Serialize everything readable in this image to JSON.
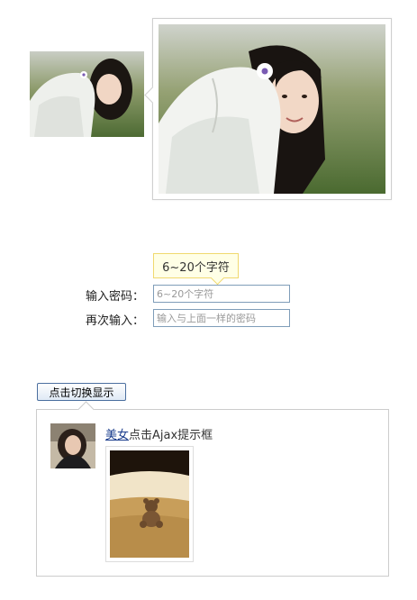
{
  "zoom_demo": {
    "small_image_icon": "girl-photo-thumbnail",
    "large_image_icon": "girl-photo-enlarged"
  },
  "password_form": {
    "tip_text": "6~20个字符",
    "password_label": "输入密码：",
    "password_placeholder": "6~20个字符",
    "confirm_label": "再次输入：",
    "confirm_placeholder": "输入与上面一样的密码"
  },
  "ajax_demo": {
    "toggle_label": "点击切换显示",
    "user_link": "美女",
    "message_text": "点击Ajax提示框",
    "avatar_icon": "woman-portrait",
    "photo_icon": "teddy-bear-on-pillow"
  }
}
